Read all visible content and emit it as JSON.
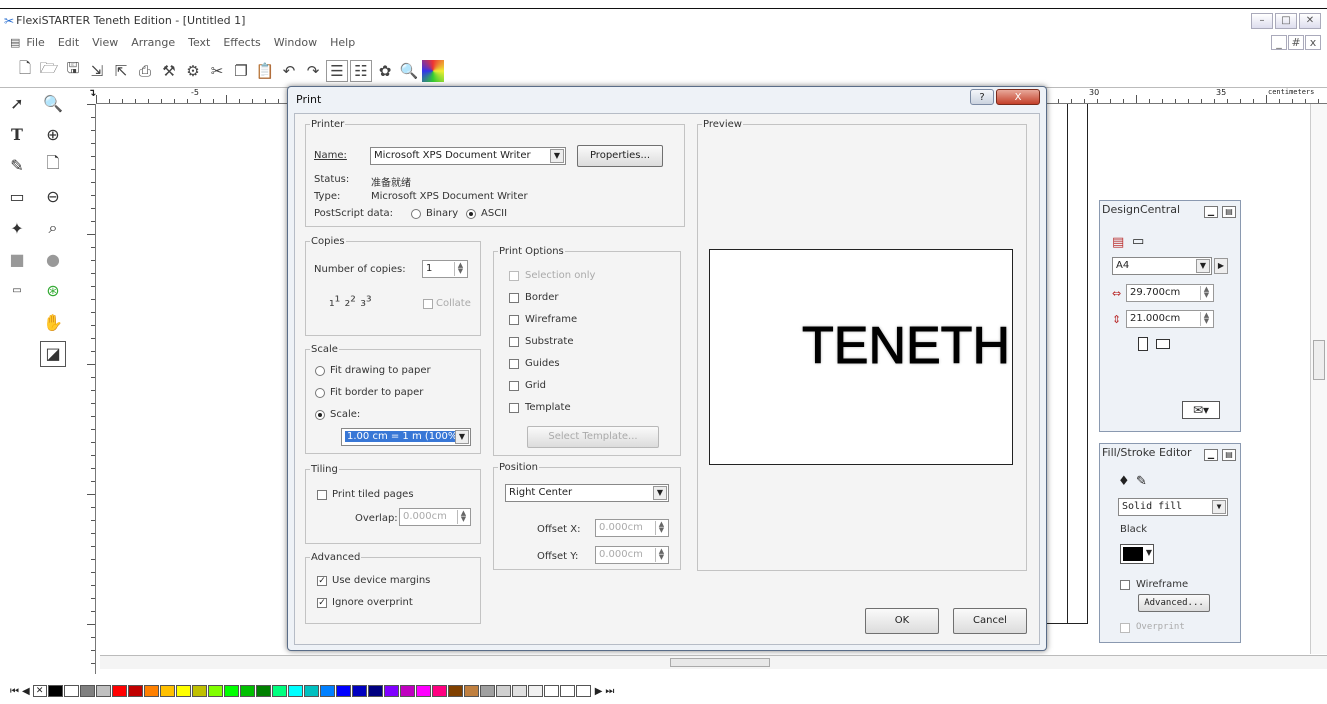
{
  "window": {
    "title": "FlexiSTARTER Teneth Edition - [Untitled 1]",
    "controls": [
      "–",
      "□",
      "✕"
    ],
    "child_controls": [
      "_",
      "#",
      "x"
    ]
  },
  "menu": [
    "File",
    "Edit",
    "View",
    "Arrange",
    "Text",
    "Effects",
    "Window",
    "Help"
  ],
  "toolbar_icons": [
    "new-icon",
    "open-icon",
    "save-icon",
    "import-icon",
    "export-icon",
    "print-icon",
    "cut-plot-icon",
    "plotter-icon",
    "cut-icon",
    "copy-icon",
    "paste-icon",
    "undo-icon",
    "redo-icon",
    "align-icon",
    "distribute-icon",
    "color-icon",
    "zoom-icon",
    "palette-icon"
  ],
  "ruler": {
    "marks": [
      "-5",
      "30",
      "35"
    ],
    "unit": "centimeters"
  },
  "dialog": {
    "title": "Print",
    "help_label": "?",
    "close_label": "X",
    "printer": {
      "legend": "Printer",
      "name_label": "Name:",
      "name_value": "Microsoft XPS Document Writer",
      "properties_label": "Properties...",
      "status_label": "Status:",
      "status_value": "准备就绪",
      "type_label": "Type:",
      "type_value": "Microsoft XPS Document Writer",
      "postscript_label": "PostScript data:",
      "binary_label": "Binary",
      "ascii_label": "ASCII"
    },
    "copies": {
      "legend": "Copies",
      "number_label": "Number of copies:",
      "number_value": "1",
      "collate_label": "Collate"
    },
    "scale": {
      "legend": "Scale",
      "fit_drawing_label": "Fit drawing to paper",
      "fit_border_label": "Fit border to paper",
      "scale_label": "Scale:",
      "scale_value": "1.00 cm = 1 m (100%)"
    },
    "tiling": {
      "legend": "Tiling",
      "print_tiled_label": "Print tiled pages",
      "overlap_label": "Overlap:",
      "overlap_value": "0.000cm"
    },
    "advanced": {
      "legend": "Advanced",
      "device_margins_label": "Use device margins",
      "ignore_overprint_label": "Ignore overprint"
    },
    "print_options": {
      "legend": "Print Options",
      "selection_only": "Selection only",
      "border": "Border",
      "wireframe": "Wireframe",
      "substrate": "Substrate",
      "guides": "Guides",
      "grid": "Grid",
      "template": "Template",
      "select_template_label": "Select Template..."
    },
    "position": {
      "legend": "Position",
      "value": "Right Center",
      "offset_x_label": "Offset X:",
      "offset_x_value": "0.000cm",
      "offset_y_label": "Offset Y:",
      "offset_y_value": "0.000cm"
    },
    "preview": {
      "legend": "Preview",
      "text": "TENETH"
    },
    "ok_label": "OK",
    "cancel_label": "Cancel"
  },
  "design_central": {
    "title": "DesignCentral",
    "page_size": "A4",
    "width_value": "29.700cm",
    "height_value": "21.000cm"
  },
  "fill_stroke": {
    "title": "Fill/Stroke Editor",
    "fill_type": "Solid fill",
    "color_name": "Black",
    "wireframe_label": "Wireframe",
    "advanced_label": "Advanced...",
    "overprint_label": "Overprint"
  },
  "palette_colors": [
    "#000000",
    "#ffffff",
    "#808080",
    "#c0c0c0",
    "#ff0000",
    "#c00000",
    "#ff8000",
    "#ffc000",
    "#ffff00",
    "#c0c000",
    "#80ff00",
    "#00ff00",
    "#00c000",
    "#008000",
    "#00ff80",
    "#00ffff",
    "#00c0c0",
    "#0080ff",
    "#0000ff",
    "#0000c0",
    "#000080",
    "#8000ff",
    "#c000c0",
    "#ff00ff",
    "#ff0080",
    "#804000",
    "#c08040",
    "#a0a0a0",
    "#d0d0d0",
    "#e0e0e0",
    "#f0f0f0",
    "#ffffff",
    "#ffffff",
    "#ffffff"
  ]
}
